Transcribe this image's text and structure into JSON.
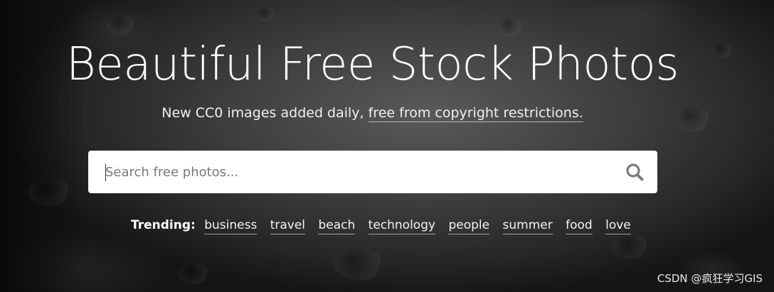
{
  "hero": {
    "title": "Beautiful Free Stock Photos",
    "subtitle_text": "New CC0 images added daily, ",
    "subtitle_link": "free from copyright restrictions."
  },
  "search": {
    "placeholder": "Search free photos...",
    "value": "",
    "button_icon": "search-icon"
  },
  "trending": {
    "label": "Trending:",
    "tags": [
      "business",
      "travel",
      "beach",
      "technology",
      "people",
      "summer",
      "food",
      "love"
    ]
  },
  "watermark": "CSDN @疯狂学习GIS",
  "colors": {
    "search_icon": "#7a7a7a",
    "search_bg": "#ffffff"
  }
}
